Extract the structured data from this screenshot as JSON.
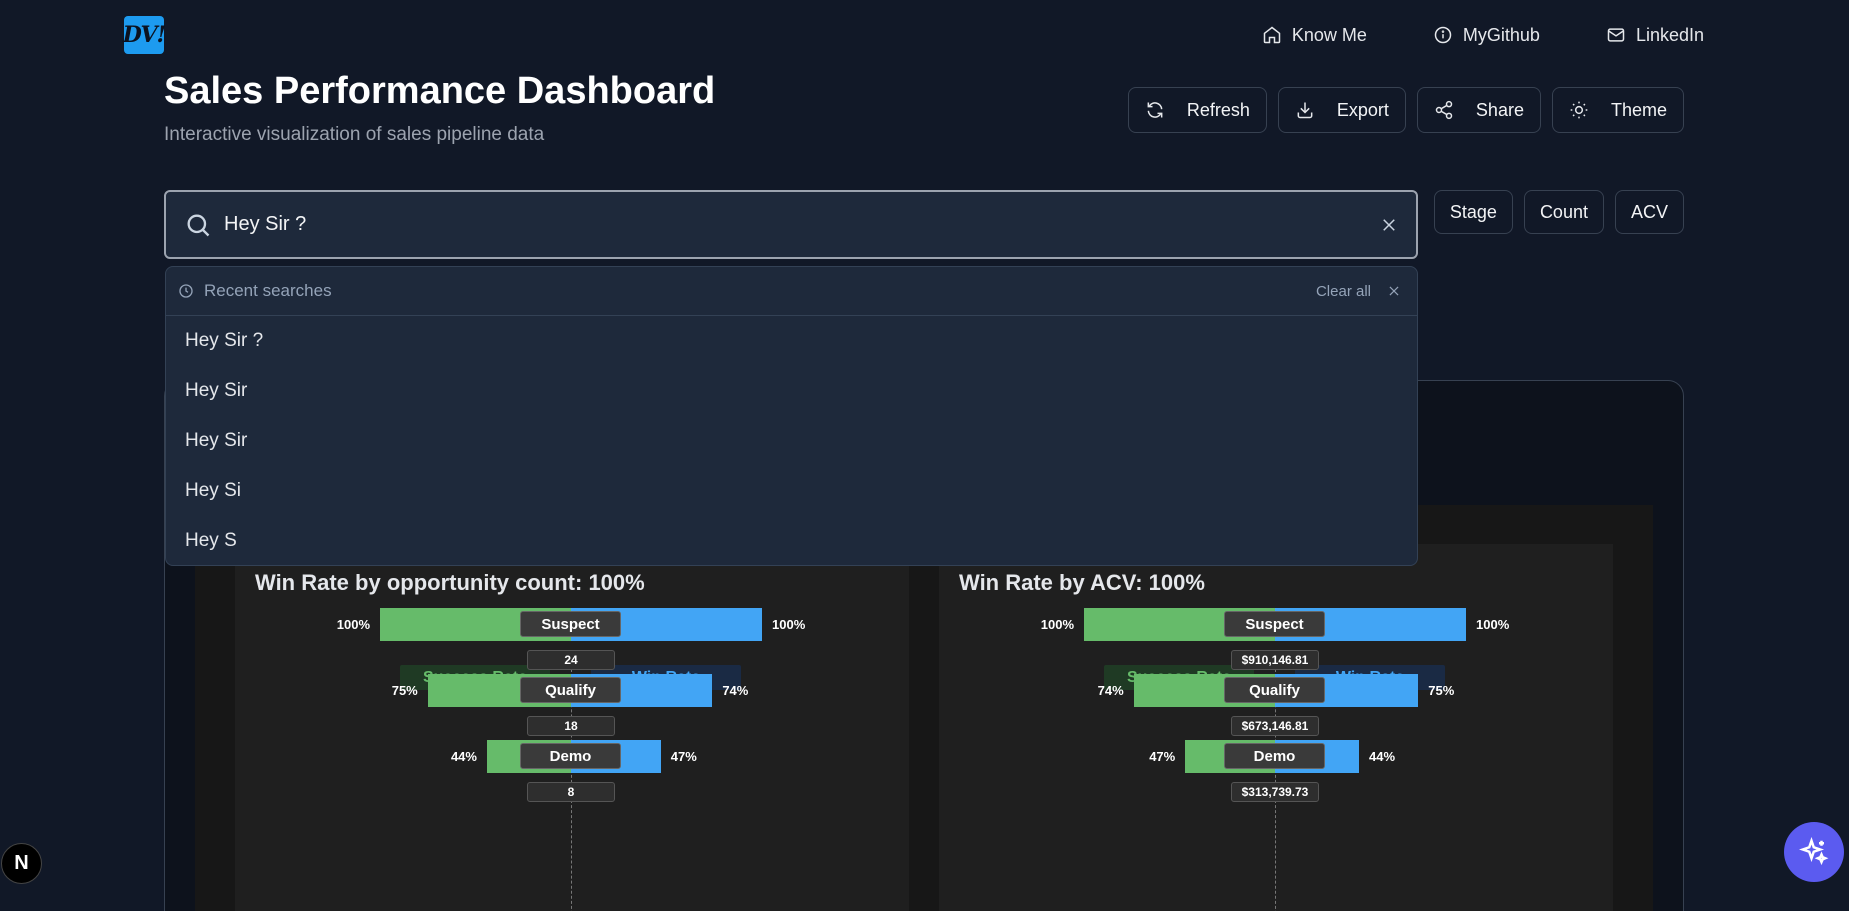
{
  "logo": {
    "text": "DV!"
  },
  "nav": {
    "items": [
      {
        "label": "Know Me",
        "icon": "home-icon"
      },
      {
        "label": "MyGithub",
        "icon": "info-icon"
      },
      {
        "label": "LinkedIn",
        "icon": "mail-icon"
      }
    ]
  },
  "header": {
    "title": "Sales Performance Dashboard",
    "subtitle": "Interactive visualization of sales pipeline data"
  },
  "actions": [
    {
      "label": "Refresh",
      "icon": "refresh-icon"
    },
    {
      "label": "Export",
      "icon": "download-icon"
    },
    {
      "label": "Share",
      "icon": "share-icon"
    },
    {
      "label": "Theme",
      "icon": "sun-icon"
    }
  ],
  "search": {
    "value": "Hey Sir ?",
    "placeholder": ""
  },
  "sort": {
    "stage": "Stage",
    "count": "Count",
    "acv": "ACV"
  },
  "recent": {
    "title": "Recent searches",
    "clear_all": "Clear all",
    "items": [
      "Hey Sir ?",
      "Hey Sir",
      "Hey Sir",
      "Hey Si",
      "Hey S"
    ]
  },
  "charts": {
    "left": {
      "title": "Win Rate by opportunity count: 100%",
      "legend_success": "Success Rate",
      "legend_win": "Win Rate",
      "stages": [
        {
          "name": "Suspect",
          "success": "100%",
          "win": "100%",
          "value": "24"
        },
        {
          "name": "Qualify",
          "success": "75%",
          "win": "74%",
          "value": "18"
        },
        {
          "name": "Demo",
          "success": "44%",
          "win": "47%",
          "value": "8"
        }
      ]
    },
    "right": {
      "title": "Win Rate by ACV: 100%",
      "legend_success": "Success Rate",
      "legend_win": "Win Rate",
      "stages": [
        {
          "name": "Suspect",
          "success": "100%",
          "win": "100%",
          "value": "$910,146.81"
        },
        {
          "name": "Qualify",
          "success": "74%",
          "win": "75%",
          "value": "$673,146.81"
        },
        {
          "name": "Demo",
          "success": "47%",
          "win": "44%",
          "value": "$313,739.73"
        }
      ]
    }
  },
  "chart_data": [
    {
      "type": "bar",
      "title": "Win Rate by opportunity count: 100%",
      "categories": [
        "Suspect",
        "Qualify",
        "Demo"
      ],
      "series": [
        {
          "name": "Success Rate",
          "values": [
            100,
            75,
            44
          ]
        },
        {
          "name": "Win Rate",
          "values": [
            100,
            74,
            47
          ]
        }
      ],
      "counts": [
        24,
        18,
        8
      ]
    },
    {
      "type": "bar",
      "title": "Win Rate by ACV: 100%",
      "categories": [
        "Suspect",
        "Qualify",
        "Demo"
      ],
      "series": [
        {
          "name": "Success Rate",
          "values": [
            100,
            74,
            47
          ]
        },
        {
          "name": "Win Rate",
          "values": [
            100,
            75,
            44
          ]
        }
      ],
      "acv": [
        "$910,146.81",
        "$673,146.81",
        "$313,739.73"
      ]
    }
  ],
  "floating": {
    "n_badge": "N"
  },
  "colors": {
    "success": "#66bb6a",
    "win": "#42a5f5",
    "accent": "#5b5bf0",
    "background": "#111827"
  }
}
